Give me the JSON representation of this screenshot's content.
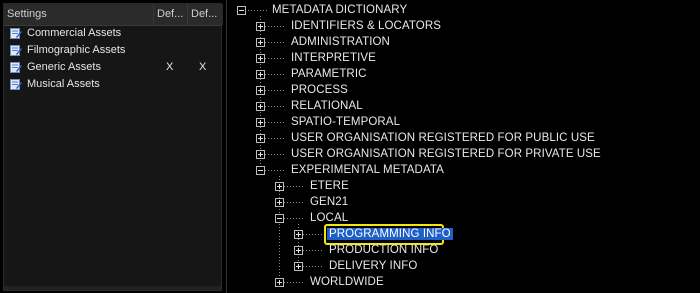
{
  "settings": {
    "columns": [
      "Settings",
      "Def...",
      "Def..."
    ],
    "rows": [
      {
        "label": "Commercial Assets",
        "col1": "",
        "col2": ""
      },
      {
        "label": "Filmographic Assets",
        "col1": "",
        "col2": ""
      },
      {
        "label": "Generic Assets",
        "col1": "X",
        "col2": "X"
      },
      {
        "label": "Musical Assets",
        "col1": "",
        "col2": ""
      }
    ]
  },
  "tree": {
    "root": "METADATA DICTIONARY",
    "level1": [
      "IDENTIFIERS & LOCATORS",
      "ADMINISTRATION",
      "INTERPRETIVE",
      "PARAMETRIC",
      "PROCESS",
      "RELATIONAL",
      "SPATIO-TEMPORAL",
      "USER ORGANISATION REGISTERED FOR PUBLIC USE",
      "USER ORGANISATION REGISTERED FOR PRIVATE USE",
      "EXPERIMENTAL METADATA"
    ],
    "experimental_children": [
      "ETERE",
      "GEN21",
      "LOCAL",
      "WORLDWIDE"
    ],
    "local_children": [
      "PROGRAMMING INFO",
      "PRODUCTION INFO",
      "DELIVERY INFO"
    ],
    "selected": "PROGRAMMING INFO"
  }
}
